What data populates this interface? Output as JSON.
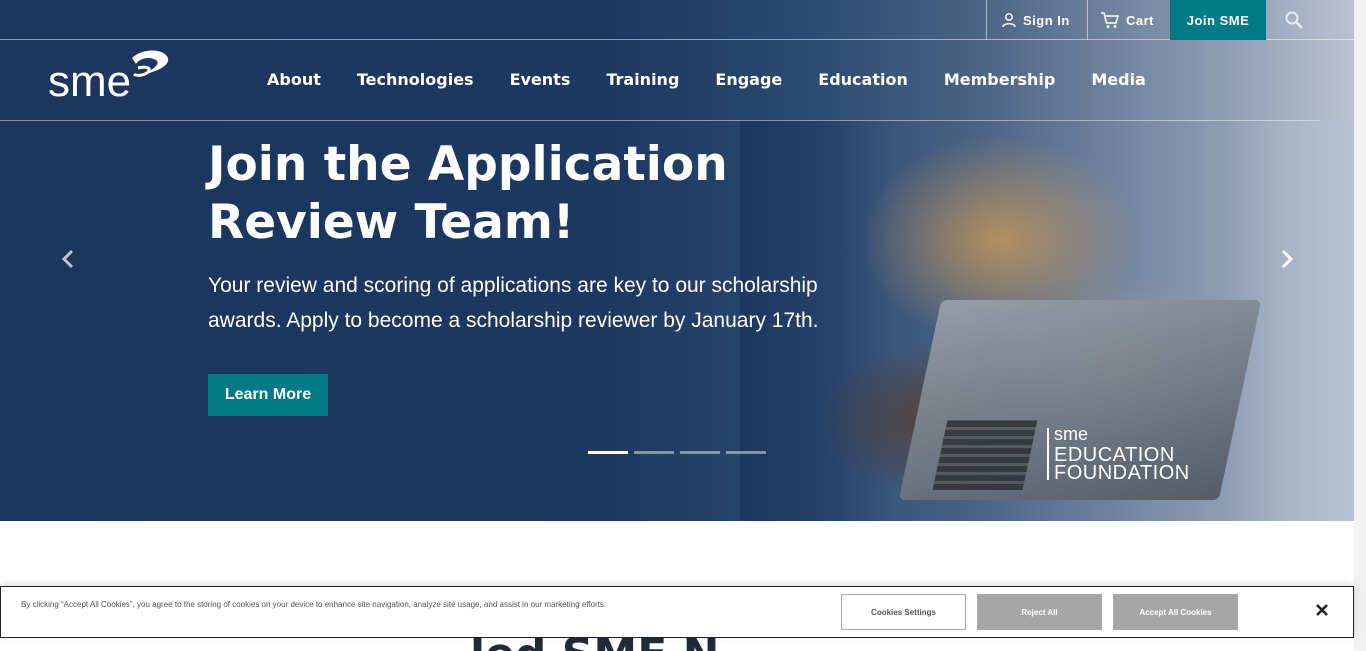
{
  "topbar": {
    "sign_in": "Sign In",
    "cart": "Cart",
    "join": "Join SME"
  },
  "logo": {
    "text": "sme"
  },
  "nav": {
    "items": [
      "About",
      "Technologies",
      "Events",
      "Training",
      "Engage",
      "Education",
      "Membership",
      "Media"
    ]
  },
  "hero": {
    "headline": "Join the Application Review Team!",
    "subtext": "Your review and scoring of applications are key to our scholarship awards. Apply to become a scholarship reviewer by January 17th.",
    "cta_label": "Learn More",
    "slides_total": 4,
    "active_slide": 1,
    "foundation_logo": {
      "brand": "sme",
      "line1": "EDUCATION",
      "line2": "FOUNDATION"
    }
  },
  "below": {
    "heading_fragment": "led SME N"
  },
  "cookie_banner": {
    "text": "By clicking “Accept All Cookies”, you agree to the storing of cookies on your device to enhance site navigation, analyze site usage, and assist in our marketing efforts.",
    "settings_label": "Cookies Settings",
    "reject_label": "Reject All",
    "accept_label": "Accept All Cookies"
  },
  "colors": {
    "hero_navy": "#1c365e",
    "accent_teal": "#007a87",
    "cookie_button_gray": "#a6a6a6"
  }
}
